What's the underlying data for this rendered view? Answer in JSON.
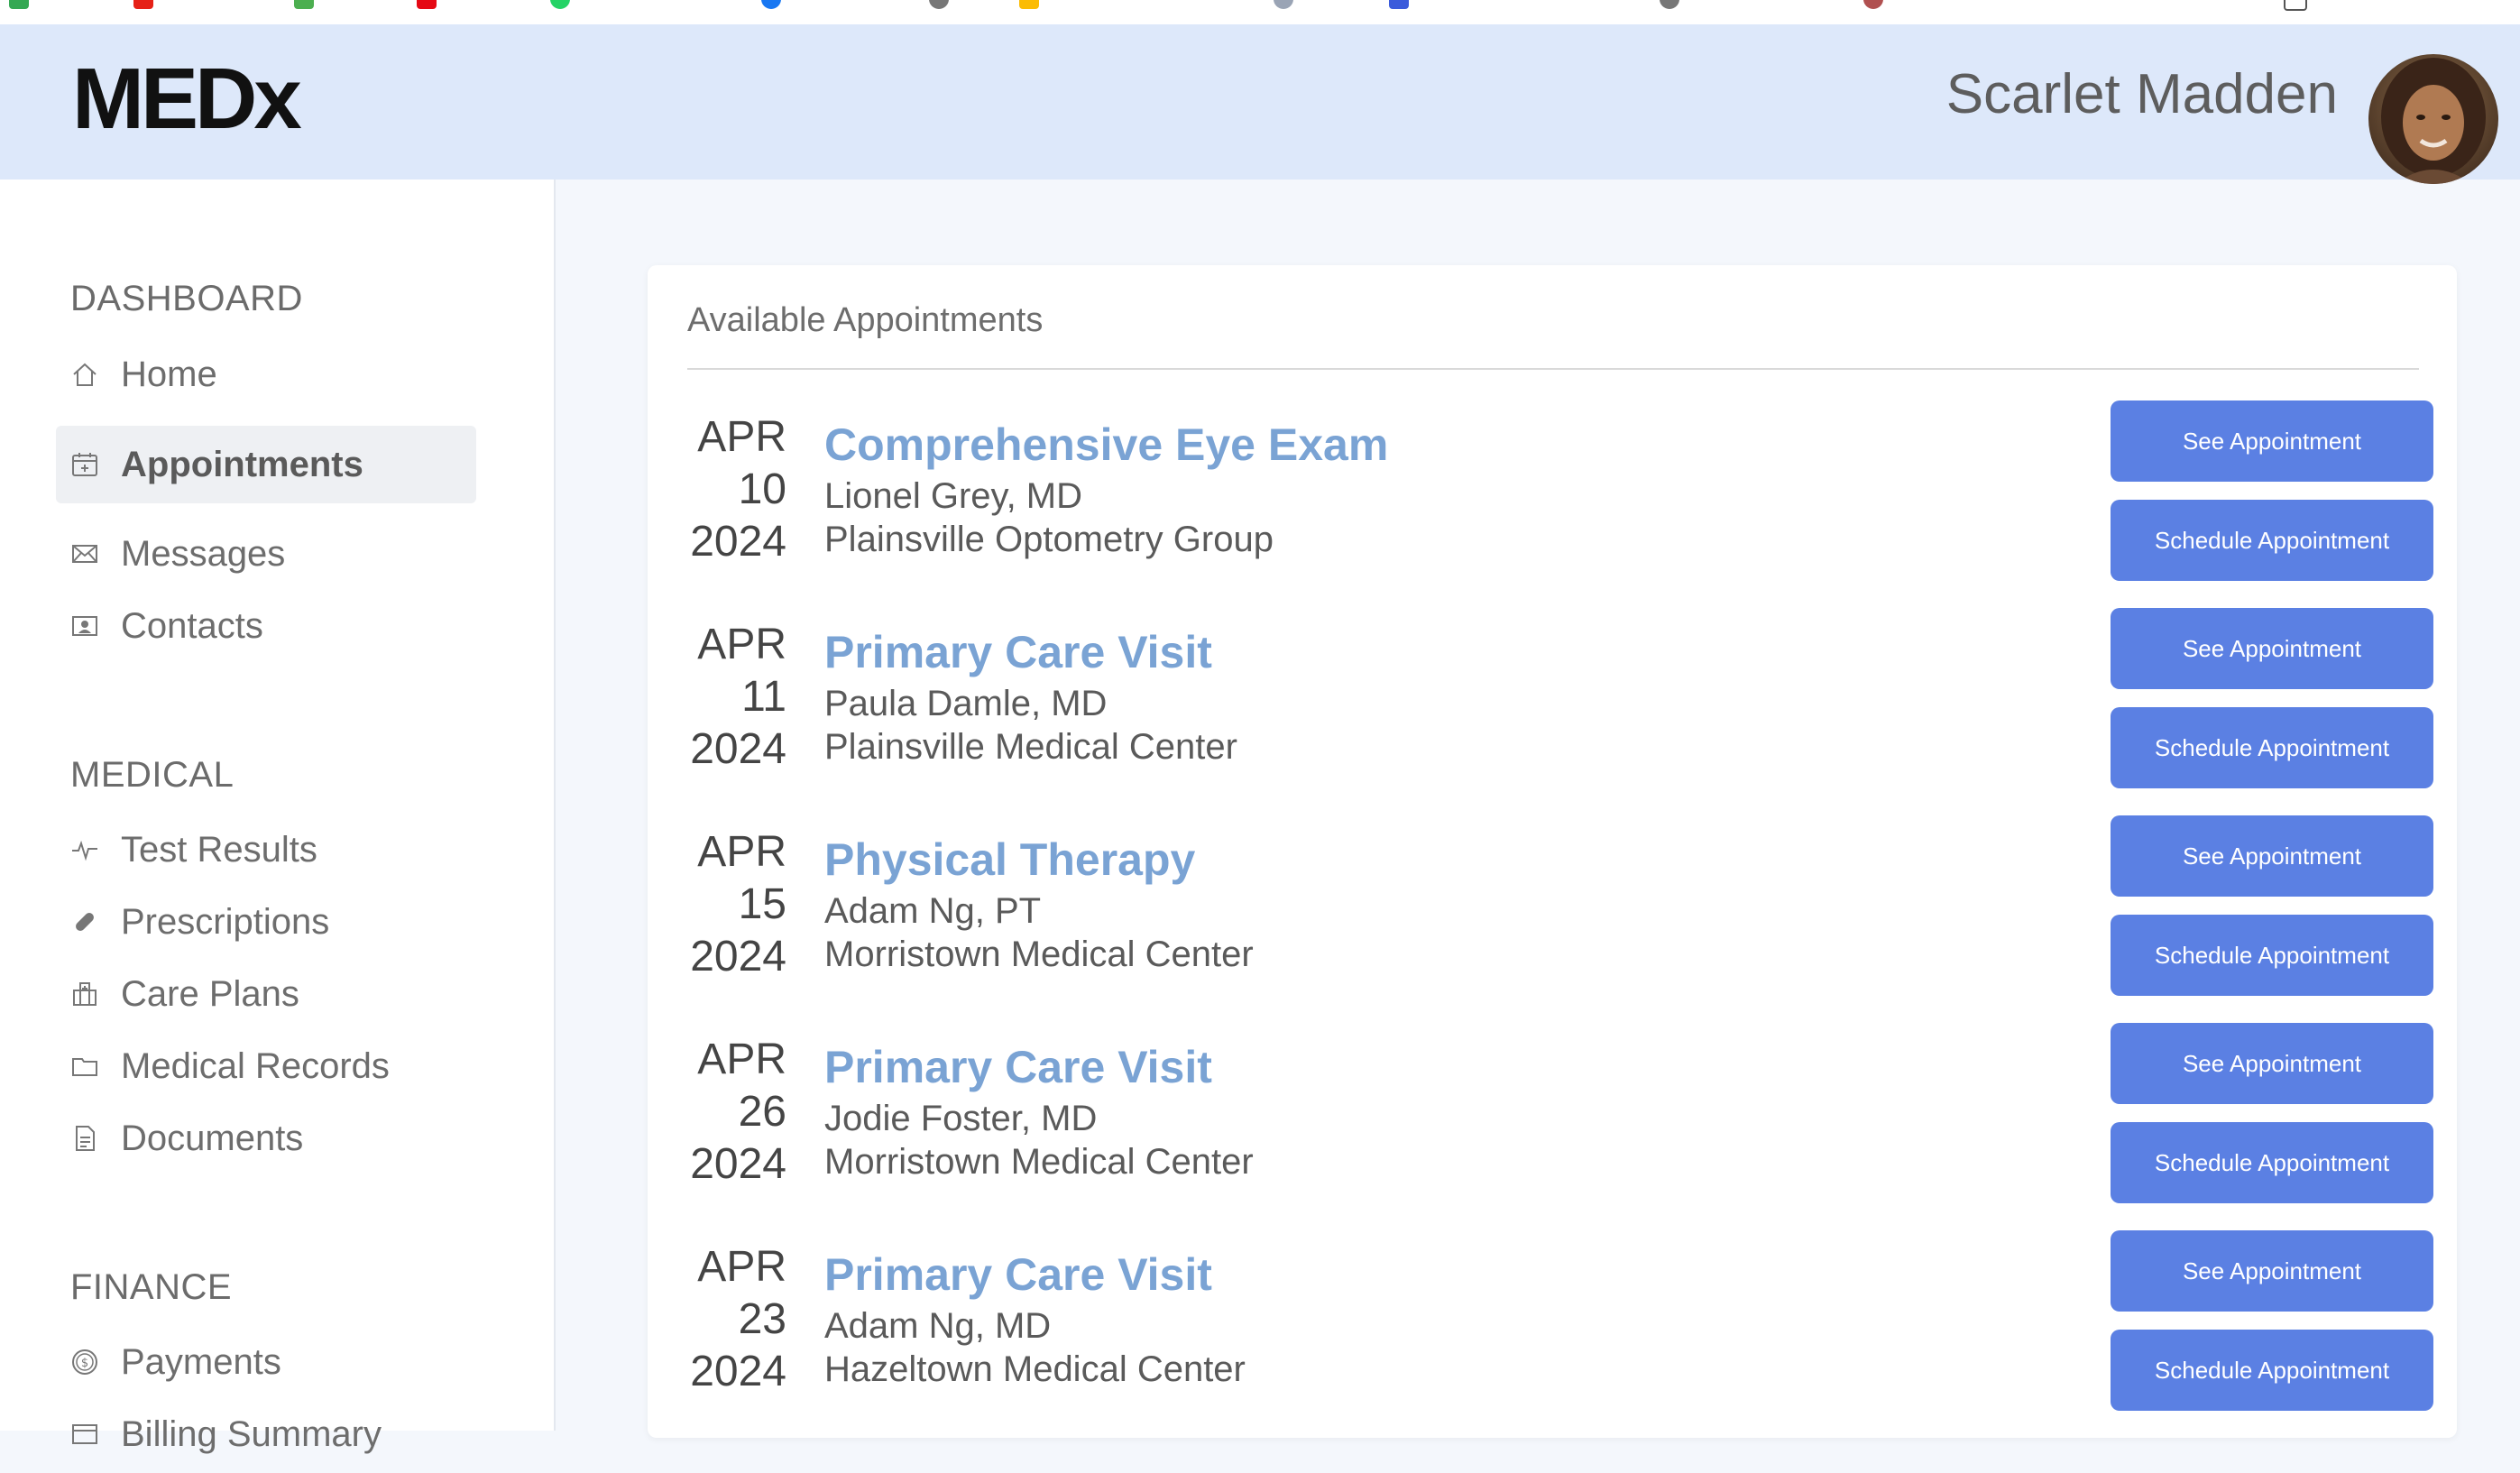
{
  "header": {
    "logo": "MEDx",
    "user_name": "Scarlet Madden"
  },
  "sidebar": {
    "sections": [
      {
        "title": "DASHBOARD",
        "items": [
          {
            "label": "Home",
            "icon": "home-icon"
          },
          {
            "label": "Appointments",
            "icon": "calendar-icon",
            "active": true
          },
          {
            "label": "Messages",
            "icon": "envelope-icon"
          },
          {
            "label": "Contacts",
            "icon": "contact-card-icon"
          }
        ]
      },
      {
        "title": "MEDICAL",
        "items": [
          {
            "label": "Test Results",
            "icon": "pulse-icon"
          },
          {
            "label": "Prescriptions",
            "icon": "pill-icon"
          },
          {
            "label": "Care Plans",
            "icon": "hospital-icon"
          },
          {
            "label": "Medical Records",
            "icon": "folder-icon"
          },
          {
            "label": "Documents",
            "icon": "document-icon"
          }
        ]
      },
      {
        "title": "FINANCE",
        "items": [
          {
            "label": "Payments",
            "icon": "dollar-coin-icon"
          },
          {
            "label": "Billing Summary",
            "icon": "billing-icon"
          }
        ]
      }
    ]
  },
  "main": {
    "card_title": "Available Appointments",
    "see_label": "See Appointment",
    "schedule_label": "Schedule Appointment",
    "appointments": [
      {
        "month": "APR",
        "day": "10",
        "year": "2024",
        "title": "Comprehensive Eye Exam",
        "doctor": "Lionel Grey, MD",
        "location": "Plainsville Optometry Group"
      },
      {
        "month": "APR",
        "day": "11",
        "year": "2024",
        "title": "Primary Care Visit",
        "doctor": "Paula Damle, MD",
        "location": "Plainsville Medical Center"
      },
      {
        "month": "APR",
        "day": "15",
        "year": "2024",
        "title": "Physical Therapy",
        "doctor": "Adam Ng, PT",
        "location": "Morristown Medical Center"
      },
      {
        "month": "APR",
        "day": "26",
        "year": "2024",
        "title": "Primary Care Visit",
        "doctor": "Jodie Foster, MD",
        "location": "Morristown Medical Center"
      },
      {
        "month": "APR",
        "day": "23",
        "year": "2024",
        "title": "Primary Care Visit",
        "doctor": "Adam Ng, MD",
        "location": "Hazeltown Medical Center"
      }
    ]
  },
  "colors": {
    "header_bg": "#dde8fa",
    "button_bg": "#5b80e3",
    "title_link": "#7aa3d4"
  }
}
